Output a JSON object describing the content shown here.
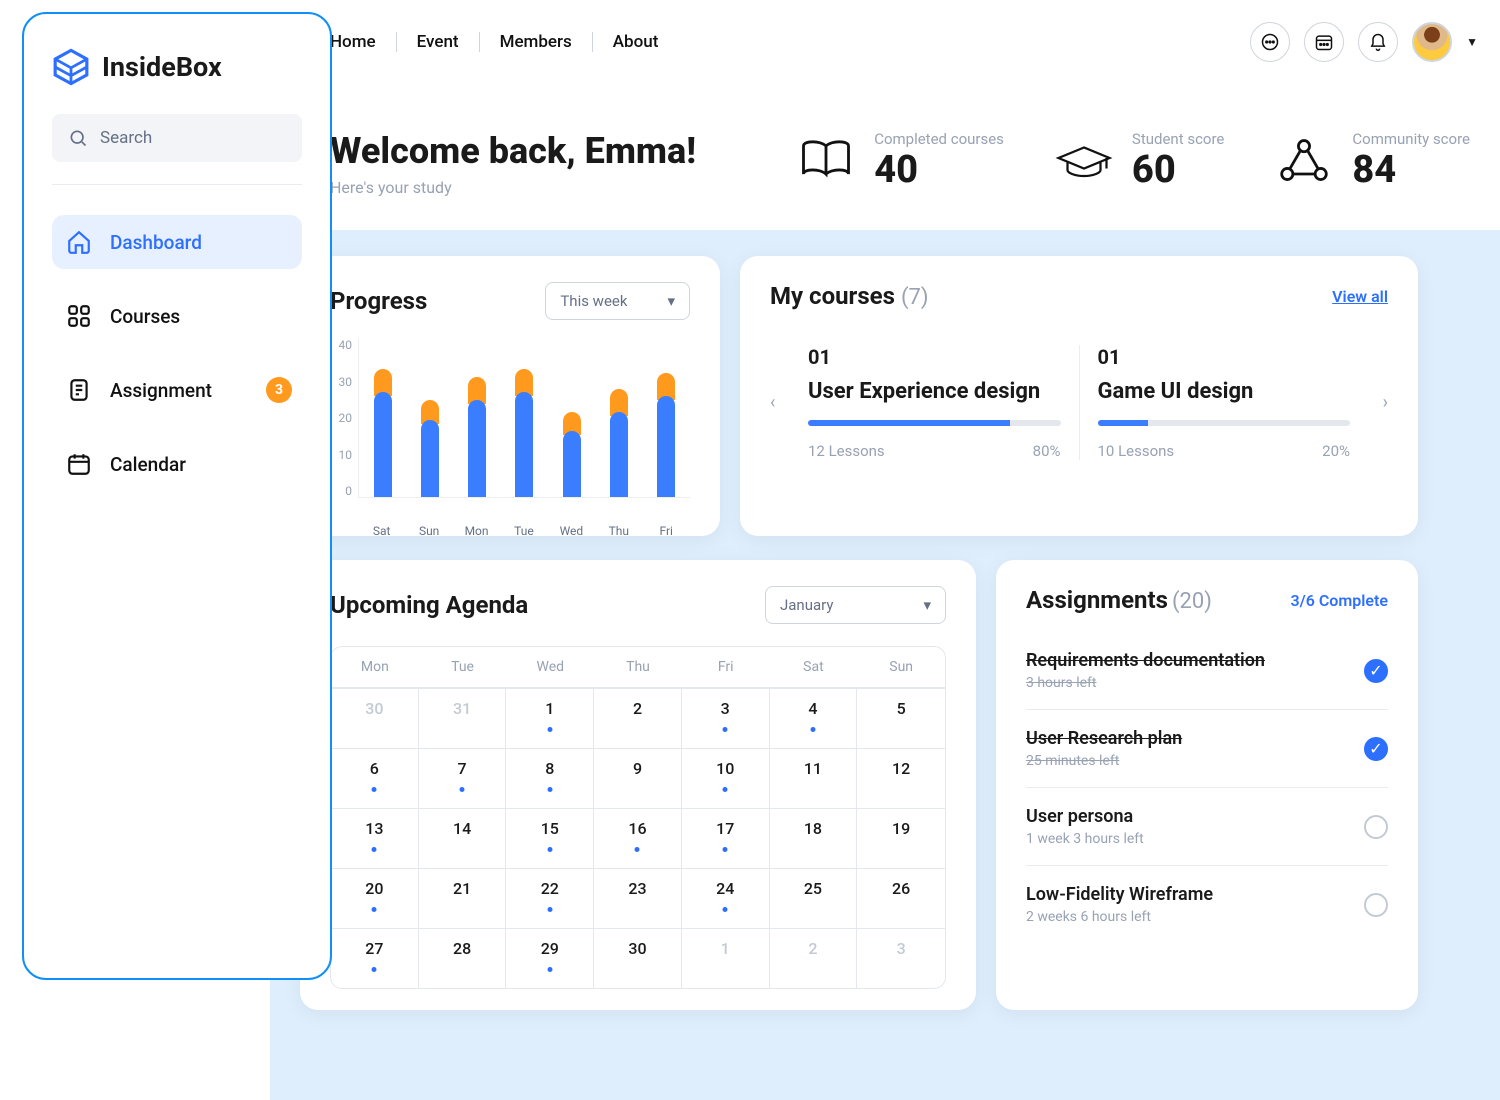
{
  "brand": "InsideBox",
  "topnav": {
    "items": [
      "Home",
      "Event",
      "Members",
      "About"
    ]
  },
  "sidebar": {
    "search_placeholder": "Search",
    "items": [
      {
        "label": "Dashboard",
        "icon": "home-icon",
        "active": true
      },
      {
        "label": "Courses",
        "icon": "grid-icon"
      },
      {
        "label": "Assignment",
        "icon": "doc-icon",
        "badge": "3"
      },
      {
        "label": "Calendar",
        "icon": "calendar-icon"
      }
    ]
  },
  "headline": {
    "title": "Welcome back, Emma!",
    "subtitle": "Here's your study"
  },
  "stats": [
    {
      "label": "Completed courses",
      "value": "40",
      "icon": "book-icon"
    },
    {
      "label": "Student score",
      "value": "60",
      "icon": "cap-icon"
    },
    {
      "label": "Community score",
      "value": "84",
      "icon": "share-icon"
    }
  ],
  "progress": {
    "title": "Progress",
    "range": "This week",
    "y_ticks": [
      "40",
      "30",
      "20",
      "10",
      "0"
    ]
  },
  "chart_data": {
    "type": "bar",
    "title": "Progress",
    "xlabel": "",
    "ylabel": "",
    "ylim": [
      0,
      40
    ],
    "categories": [
      "Sat",
      "Sun",
      "Mon",
      "Tue",
      "Wed",
      "Thu",
      "Fri"
    ],
    "series": [
      {
        "name": "blue",
        "values": [
          27,
          20,
          25,
          27,
          17,
          22,
          26
        ]
      },
      {
        "name": "orange",
        "values": [
          7,
          6,
          7,
          7,
          6,
          7,
          7
        ]
      }
    ],
    "stacked": true,
    "totals": [
      34,
      26,
      32,
      34,
      23,
      29,
      33
    ]
  },
  "courses": {
    "title": "My courses",
    "count": "(7)",
    "viewall": "View all",
    "items": [
      {
        "num": "01",
        "name": "User Experience design",
        "lessons": "12 Lessons",
        "pct_label": "80%",
        "pct": 80
      },
      {
        "num": "01",
        "name": "Game UI design",
        "lessons": "10 Lessons",
        "pct_label": "20%",
        "pct": 20
      }
    ]
  },
  "agenda": {
    "title": "Upcoming Agenda",
    "month": "January",
    "dow": [
      "Mon",
      "Tue",
      "Wed",
      "Thu",
      "Fri",
      "Sat",
      "Sun"
    ],
    "cells": [
      {
        "d": "30",
        "dim": true
      },
      {
        "d": "31",
        "dim": true
      },
      {
        "d": "1",
        "dot": true
      },
      {
        "d": "2"
      },
      {
        "d": "3",
        "dot": true
      },
      {
        "d": "4",
        "dot": true
      },
      {
        "d": "5"
      },
      {
        "d": "6",
        "dot": true
      },
      {
        "d": "7",
        "dot": true
      },
      {
        "d": "8",
        "dot": true
      },
      {
        "d": "9"
      },
      {
        "d": "10",
        "dot": true
      },
      {
        "d": "11"
      },
      {
        "d": "12"
      },
      {
        "d": "13",
        "dot": true
      },
      {
        "d": "14"
      },
      {
        "d": "15",
        "dot": true
      },
      {
        "d": "16",
        "dot": true
      },
      {
        "d": "17",
        "dot": true
      },
      {
        "d": "18"
      },
      {
        "d": "19"
      },
      {
        "d": "20",
        "dot": true
      },
      {
        "d": "21"
      },
      {
        "d": "22",
        "dot": true
      },
      {
        "d": "23"
      },
      {
        "d": "24",
        "dot": true
      },
      {
        "d": "25"
      },
      {
        "d": "26"
      },
      {
        "d": "27",
        "dot": true
      },
      {
        "d": "28"
      },
      {
        "d": "29",
        "dot": true
      },
      {
        "d": "30"
      },
      {
        "d": "1",
        "dim": true
      },
      {
        "d": "2",
        "dim": true
      },
      {
        "d": "3",
        "dim": true
      }
    ]
  },
  "assignments": {
    "title": "Assignments",
    "count": "(20)",
    "ratio": "3/6 Complete",
    "items": [
      {
        "title": "Requirements documentation",
        "sub": "3 hours left",
        "done": true
      },
      {
        "title": "User Research plan",
        "sub": "25 minutes left",
        "done": true
      },
      {
        "title": "User persona",
        "sub": "1 week 3 hours left",
        "done": false
      },
      {
        "title": "Low-Fidelity Wireframe",
        "sub": "2 weeks 6 hours left",
        "done": false
      }
    ]
  }
}
